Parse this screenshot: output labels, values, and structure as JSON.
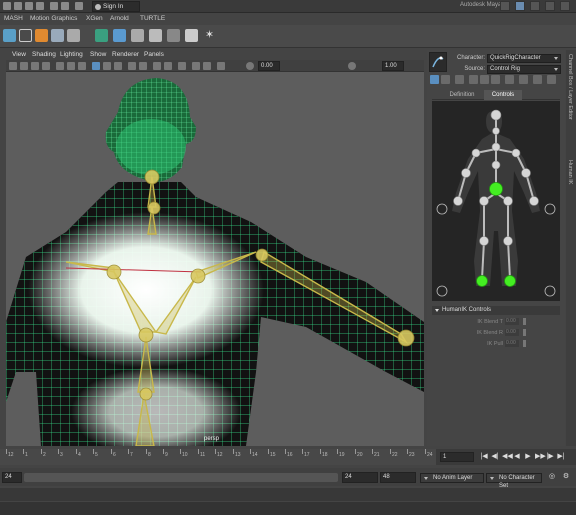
{
  "topbar": {
    "sign_in": "Sign In",
    "app_title": "Autodesk Maya"
  },
  "shelf_tabs": [
    "MASH",
    "Motion Graphics",
    "XGen",
    "Arnold",
    "TURTLE"
  ],
  "viewport_menu": [
    "View",
    "Shading",
    "Lighting",
    "Show",
    "Renderer",
    "Panels"
  ],
  "viewport_toolbar": {
    "value_a": "0.00",
    "value_b": "1.00"
  },
  "viewport": {
    "camera_label": "persp"
  },
  "hik": {
    "character_label": "Character:",
    "character_value": "QuickRigCharacter",
    "source_label": "Source:",
    "source_value": "Control Rig",
    "tabs": [
      "Definition",
      "Controls"
    ],
    "active_tab": "Controls",
    "controls_header": "HumanIK Controls",
    "blends": [
      {
        "label": "IK Blend T",
        "value": "0.00"
      },
      {
        "label": "IK Blend R",
        "value": "0.00"
      },
      {
        "label": "IK Pull",
        "value": "0.00"
      }
    ]
  },
  "side_tabs": [
    "Channel Box / Layer Editor",
    "Human IK"
  ],
  "timeline": {
    "ticks": [
      "12",
      "1",
      "2",
      "3",
      "4",
      "5",
      "6",
      "7",
      "8",
      "9",
      "10",
      "11",
      "12",
      "13",
      "14",
      "15",
      "16",
      "17",
      "18",
      "19",
      "20",
      "21",
      "22",
      "23",
      "24"
    ],
    "current_frame": "1",
    "playback": [
      "|◀",
      "◀|",
      "◀◀",
      "◀",
      "▶",
      "▶▶",
      "|▶",
      "▶|"
    ]
  },
  "range": {
    "start": "24",
    "end_a": "24",
    "end_b": "48",
    "anim_layer": "No Anim Layer",
    "character_set": "No Character Set"
  },
  "colors": {
    "wireframe": "#38e08a",
    "joint": "#c8b84a",
    "hik_effector_green": "#44ee22"
  }
}
